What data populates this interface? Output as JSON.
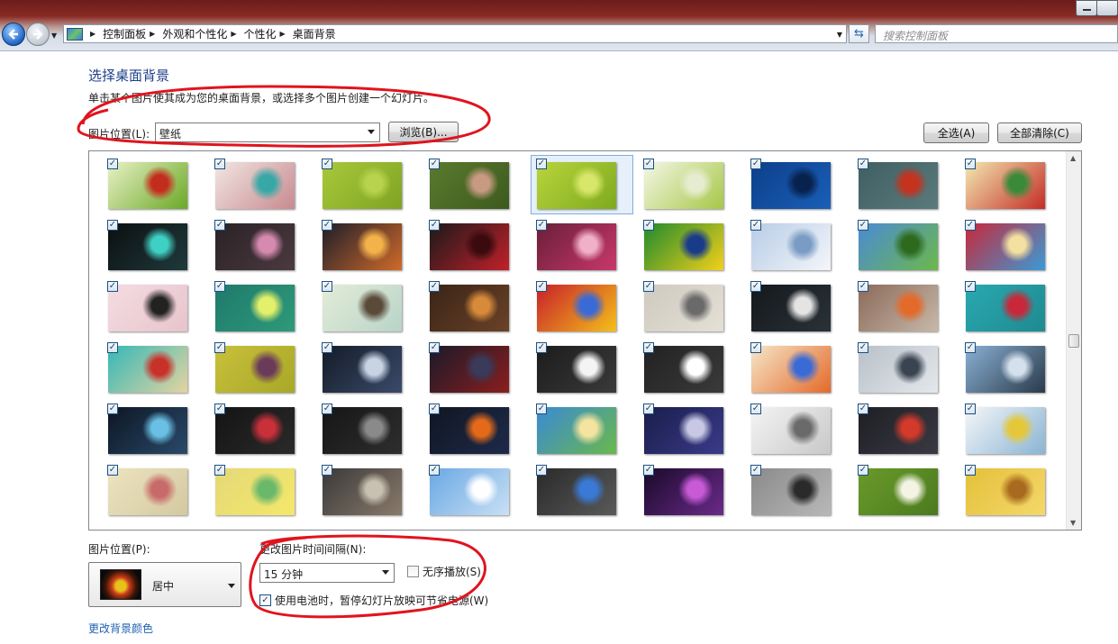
{
  "window": {
    "title_bar_glyph": "Color Chooser",
    "buttons": [
      "minimize",
      "maximize",
      "close"
    ]
  },
  "nav": {
    "back_icon": "back-arrow-icon",
    "forward_icon": "forward-arrow-icon"
  },
  "address": {
    "crumbs": [
      "控制面板",
      "外观和个性化",
      "个性化",
      "桌面背景"
    ]
  },
  "search": {
    "placeholder": "搜索控制面板"
  },
  "page": {
    "title": "选择桌面背景",
    "description": "单击某个图片使其成为您的桌面背景，或选择多个图片创建一个幻灯片。"
  },
  "location": {
    "label": "图片位置(L):",
    "value": "壁纸",
    "browse_label": "浏览(B)...",
    "select_all_label": "全选(A)",
    "clear_all_label": "全部清除(C)"
  },
  "thumbnails": [
    {
      "checked": true,
      "selected": false,
      "colors": [
        "#e9f1c6",
        "#6aa826",
        "#c32d1e"
      ]
    },
    {
      "checked": true,
      "selected": false,
      "colors": [
        "#f1e6e2",
        "#c88a90",
        "#37a8a6"
      ]
    },
    {
      "checked": true,
      "selected": false,
      "colors": [
        "#a8c83a",
        "#7fa424",
        "#b8d44e"
      ]
    },
    {
      "checked": true,
      "selected": false,
      "colors": [
        "#5a7a2e",
        "#3d5a1e",
        "#c89a82"
      ]
    },
    {
      "checked": true,
      "selected": true,
      "colors": [
        "#b8d43c",
        "#7eaa1e",
        "#d8e66a"
      ]
    },
    {
      "checked": true,
      "selected": false,
      "colors": [
        "#f4f6e6",
        "#a6c846",
        "#e6ecd0"
      ]
    },
    {
      "checked": true,
      "selected": false,
      "colors": [
        "#0d3f8a",
        "#1a5fb8",
        "#08224e"
      ]
    },
    {
      "checked": true,
      "selected": false,
      "colors": [
        "#3f5f62",
        "#5b7a7c",
        "#c4331e"
      ]
    },
    {
      "checked": true,
      "selected": false,
      "colors": [
        "#f3e8b0",
        "#c32d26",
        "#3a8a3a"
      ]
    },
    {
      "checked": true,
      "selected": false,
      "colors": [
        "#0c0f10",
        "#1f3a3c",
        "#3fd0c4"
      ]
    },
    {
      "checked": true,
      "selected": false,
      "colors": [
        "#2a2226",
        "#4b3a40",
        "#d68ab0"
      ]
    },
    {
      "checked": true,
      "selected": false,
      "colors": [
        "#1e1e2a",
        "#d06a2a",
        "#f4b24a"
      ]
    },
    {
      "checked": true,
      "selected": false,
      "colors": [
        "#1a1a1a",
        "#c3202a",
        "#3a0a0e"
      ]
    },
    {
      "checked": true,
      "selected": false,
      "colors": [
        "#6a1e3a",
        "#c8386a",
        "#f0b0c8"
      ]
    },
    {
      "checked": true,
      "selected": false,
      "colors": [
        "#1f8a2e",
        "#f4d01a",
        "#1a3a8a"
      ]
    },
    {
      "checked": true,
      "selected": false,
      "colors": [
        "#b8cce6",
        "#f4f6fa",
        "#7a9cc4"
      ]
    },
    {
      "checked": true,
      "selected": false,
      "colors": [
        "#4a8ad6",
        "#6cb84a",
        "#2e6a1e"
      ]
    },
    {
      "checked": true,
      "selected": false,
      "colors": [
        "#c8283a",
        "#3a9ad6",
        "#f4e0a0"
      ]
    },
    {
      "checked": true,
      "selected": false,
      "colors": [
        "#f4dce2",
        "#e8c4cc",
        "#222222"
      ]
    },
    {
      "checked": true,
      "selected": false,
      "colors": [
        "#1e7a6a",
        "#2e9a7a",
        "#e4f06a"
      ]
    },
    {
      "checked": true,
      "selected": false,
      "colors": [
        "#e4ecd8",
        "#b8d4c8",
        "#5a4a3a"
      ]
    },
    {
      "checked": true,
      "selected": false,
      "colors": [
        "#3a2416",
        "#6a4228",
        "#d68a3a"
      ]
    },
    {
      "checked": true,
      "selected": false,
      "colors": [
        "#c8202a",
        "#f4c01a",
        "#3a6ad6"
      ]
    },
    {
      "checked": true,
      "selected": false,
      "colors": [
        "#cfcac0",
        "#e4e0d6",
        "#6a6a6a"
      ]
    },
    {
      "checked": true,
      "selected": false,
      "colors": [
        "#14181c",
        "#2a3238",
        "#e4e4e4"
      ]
    },
    {
      "checked": true,
      "selected": false,
      "colors": [
        "#8a6a5a",
        "#c8b8a8",
        "#e46a2a"
      ]
    },
    {
      "checked": true,
      "selected": false,
      "colors": [
        "#2aa8b0",
        "#1e8a90",
        "#c8283a"
      ]
    },
    {
      "checked": true,
      "selected": false,
      "colors": [
        "#34b8b8",
        "#e4d4a0",
        "#c8302a"
      ]
    },
    {
      "checked": true,
      "selected": false,
      "colors": [
        "#c8c03a",
        "#a8a828",
        "#6a3a5a"
      ]
    },
    {
      "checked": true,
      "selected": false,
      "colors": [
        "#141c28",
        "#3a4a6a",
        "#c8d4e4"
      ]
    },
    {
      "checked": true,
      "selected": false,
      "colors": [
        "#1a1a2a",
        "#8a1e1e",
        "#3a3a5a"
      ]
    },
    {
      "checked": true,
      "selected": false,
      "colors": [
        "#1c1c1c",
        "#3a3a3a",
        "#f4f4f4"
      ]
    },
    {
      "checked": true,
      "selected": false,
      "colors": [
        "#222222",
        "#3a3a3a",
        "#ffffff"
      ]
    },
    {
      "checked": true,
      "selected": false,
      "colors": [
        "#f6e6c8",
        "#e46a2a",
        "#3a6ad6"
      ]
    },
    {
      "checked": true,
      "selected": false,
      "colors": [
        "#b8c0c8",
        "#e4e8ec",
        "#3a4450"
      ]
    },
    {
      "checked": true,
      "selected": false,
      "colors": [
        "#8ab0d4",
        "#2a3a4a",
        "#d4e0ec"
      ]
    },
    {
      "checked": true,
      "selected": false,
      "colors": [
        "#0c1624",
        "#2a4a6a",
        "#6ac0e4"
      ]
    },
    {
      "checked": true,
      "selected": false,
      "colors": [
        "#141414",
        "#2a2a2a",
        "#c8303a"
      ]
    },
    {
      "checked": true,
      "selected": false,
      "colors": [
        "#161616",
        "#2e2e2e",
        "#8a8a8a"
      ]
    },
    {
      "checked": true,
      "selected": false,
      "colors": [
        "#101622",
        "#1e2a4a",
        "#e46a1a"
      ]
    },
    {
      "checked": true,
      "selected": false,
      "colors": [
        "#3a8ad6",
        "#6ab84a",
        "#f4e4a0"
      ]
    },
    {
      "checked": true,
      "selected": false,
      "colors": [
        "#1a1e4a",
        "#3a3a8a",
        "#c8c8e4"
      ]
    },
    {
      "checked": true,
      "selected": false,
      "colors": [
        "#f4f4f4",
        "#c8c8c8",
        "#6a6a6a"
      ]
    },
    {
      "checked": true,
      "selected": false,
      "colors": [
        "#1e1e24",
        "#3a3a44",
        "#d43a2a"
      ]
    },
    {
      "checked": true,
      "selected": false,
      "colors": [
        "#f4f6f8",
        "#8ab4d4",
        "#e4c83a"
      ]
    },
    {
      "checked": true,
      "selected": false,
      "colors": [
        "#ece4c0",
        "#d4c8a0",
        "#c86a6a"
      ]
    },
    {
      "checked": true,
      "selected": false,
      "colors": [
        "#e4d878",
        "#f4e86a",
        "#6ab86a"
      ]
    },
    {
      "checked": true,
      "selected": false,
      "colors": [
        "#3a3a3a",
        "#8a7a6a",
        "#c8c0b0"
      ]
    },
    {
      "checked": true,
      "selected": false,
      "colors": [
        "#6aa8e4",
        "#c8e0f4",
        "#ffffff"
      ]
    },
    {
      "checked": true,
      "selected": false,
      "colors": [
        "#2a2a2a",
        "#5a5a5a",
        "#3a7ad6"
      ]
    },
    {
      "checked": true,
      "selected": false,
      "colors": [
        "#1a0a2a",
        "#6a2a8a",
        "#c85ad6"
      ]
    },
    {
      "checked": true,
      "selected": false,
      "colors": [
        "#8a8a8a",
        "#b8b8b8",
        "#2a2a2a"
      ]
    },
    {
      "checked": true,
      "selected": false,
      "colors": [
        "#6a9a2a",
        "#4a7a1e",
        "#f4f4e4"
      ]
    },
    {
      "checked": true,
      "selected": false,
      "colors": [
        "#e4c03a",
        "#f4d86a",
        "#a86a1e"
      ]
    }
  ],
  "bottom": {
    "position_label": "图片位置(P):",
    "position_value": "居中",
    "interval_label": "更改图片时间间隔(N):",
    "interval_value": "15 分钟",
    "shuffle_label": "无序播放(S)",
    "shuffle_checked": false,
    "battery_label": "使用电池时，暂停幻灯片放映可节省电源(W)",
    "battery_checked": true,
    "bg_color_link": "更改背景颜色"
  },
  "colors": {
    "title": "#1e3f8a",
    "link": "#1e62b3",
    "annotation": "#e0141e",
    "selection": "#e6f0fa"
  }
}
